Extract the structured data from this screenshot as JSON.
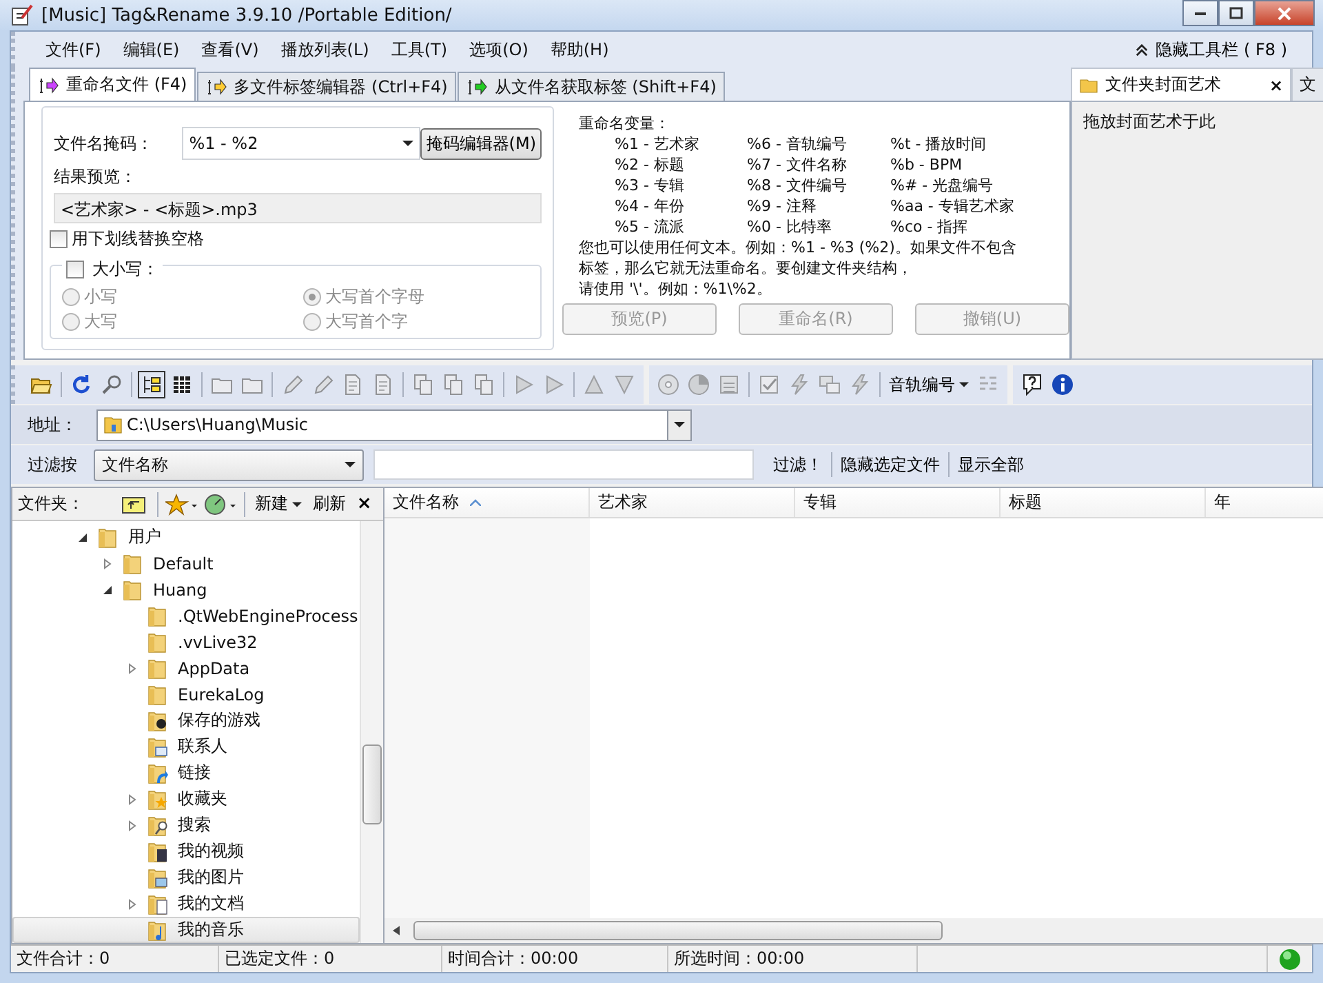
{
  "window": {
    "title": "[Music] Tag&Rename 3.9.10 /Portable Edition/"
  },
  "menu": [
    "文件(F)",
    "编辑(E)",
    "查看(V)",
    "播放列表(L)",
    "工具(T)",
    "选项(O)",
    "帮助(H)"
  ],
  "hide_toolbar": "隐藏工具栏 ( F8 )",
  "tabs": [
    {
      "label": "重命名文件 (F4)",
      "selected": true
    },
    {
      "label": "多文件标签编辑器 (Ctrl+F4)",
      "selected": false
    },
    {
      "label": "从文件名获取标签 (Shift+F4)",
      "selected": false
    }
  ],
  "rename": {
    "mask_label": "文件名掩码：",
    "mask_value": "%1 - %2",
    "mask_editor_button": "掩码编辑器(M)",
    "preview_label": "结果预览：",
    "preview_value": "<艺术家> - <标题>.mp3",
    "underscore_option": {
      "label": "用下划线替换空格",
      "checked": false
    },
    "case_group": {
      "label": "大小写：",
      "checked": false,
      "options": [
        {
          "label": "小写",
          "selected": false,
          "disabled": true
        },
        {
          "label": "大写首个字母",
          "selected": true,
          "disabled": true
        },
        {
          "label": "大写",
          "selected": false,
          "disabled": true
        },
        {
          "label": "大写首个字",
          "selected": false,
          "disabled": true
        }
      ]
    },
    "variables_title": "重命名变量：",
    "variables": [
      [
        "%1 - 艺术家",
        "%6 - 音轨编号",
        "%t - 播放时间"
      ],
      [
        "%2 - 标题",
        "%7 - 文件名称",
        "%b - BPM"
      ],
      [
        "%3 - 专辑",
        "%8 - 文件编号",
        "%# - 光盘编号"
      ],
      [
        "%4 - 年份",
        "%9 - 注释",
        "%aa - 专辑艺术家"
      ],
      [
        "%5 - 流派",
        "%0 - 比特率",
        "%co - 指挥"
      ]
    ],
    "note_lines": [
      "您也可以使用任何文本。例如：%1 - %3 (%2)。如果文件不包含",
      "标签，那么它就无法重命名。要创建文件夹结构，",
      "请使用 '\\'。例如：%1\\%2。"
    ],
    "buttons": [
      {
        "label": "预览(P)",
        "disabled": true
      },
      {
        "label": "重命名(R)",
        "disabled": true
      },
      {
        "label": "撤销(U)",
        "disabled": true
      }
    ]
  },
  "cover_art": {
    "tabs": [
      {
        "label": "文件夹封面艺术",
        "selected": true
      },
      {
        "label": "文",
        "selected": false
      }
    ],
    "close": "×",
    "hint": "拖放封面艺术于此"
  },
  "toolbar": {
    "track_number_menu": "音轨编号"
  },
  "address": {
    "label": "地址：",
    "value": "C:\\Users\\Huang\\Music"
  },
  "filter": {
    "label": "过滤按",
    "field": "文件名称",
    "buttons": [
      "过滤！",
      "隐藏选定文件",
      "显示全部"
    ]
  },
  "folder_pane": {
    "title": "文件夹：",
    "new_menu": "新建",
    "refresh": "刷新",
    "close": "×"
  },
  "folder_tree": [
    {
      "label": "用户",
      "kind": "folder",
      "expanded": true,
      "selected": false,
      "children": [
        {
          "label": "Default",
          "kind": "folder",
          "expanded": false,
          "selected": false
        },
        {
          "label": "Huang",
          "kind": "folder",
          "expanded": true,
          "selected": false,
          "children": [
            {
              "label": ".QtWebEngineProcess",
              "kind": "folder",
              "selected": false
            },
            {
              "label": ".vvLive32",
              "kind": "folder",
              "selected": false
            },
            {
              "label": "AppData",
              "kind": "folder",
              "expanded": false,
              "selected": false
            },
            {
              "label": "EurekaLog",
              "kind": "folder",
              "selected": false
            },
            {
              "label": "保存的游戏",
              "kind": "games",
              "selected": false
            },
            {
              "label": "联系人",
              "kind": "contacts",
              "selected": false
            },
            {
              "label": "链接",
              "kind": "links",
              "selected": false
            },
            {
              "label": "收藏夹",
              "kind": "favorites",
              "expanded": false,
              "selected": false
            },
            {
              "label": "搜索",
              "kind": "search",
              "expanded": false,
              "selected": false
            },
            {
              "label": "我的视频",
              "kind": "videos",
              "selected": false
            },
            {
              "label": "我的图片",
              "kind": "pictures",
              "selected": false
            },
            {
              "label": "我的文档",
              "kind": "documents",
              "expanded": false,
              "selected": false
            },
            {
              "label": "我的音乐",
              "kind": "music",
              "selected": true
            }
          ]
        }
      ]
    }
  ],
  "file_list": {
    "columns": [
      {
        "label": "文件名称",
        "sorted": true
      },
      {
        "label": "艺术家",
        "sorted": false
      },
      {
        "label": "专辑",
        "sorted": false
      },
      {
        "label": "标题",
        "sorted": false
      },
      {
        "label": "年",
        "sorted": false
      }
    ]
  },
  "status_bar": [
    "文件合计：0",
    "已选定文件：0",
    "时间合计：00:00",
    "所选时间：00:00"
  ]
}
